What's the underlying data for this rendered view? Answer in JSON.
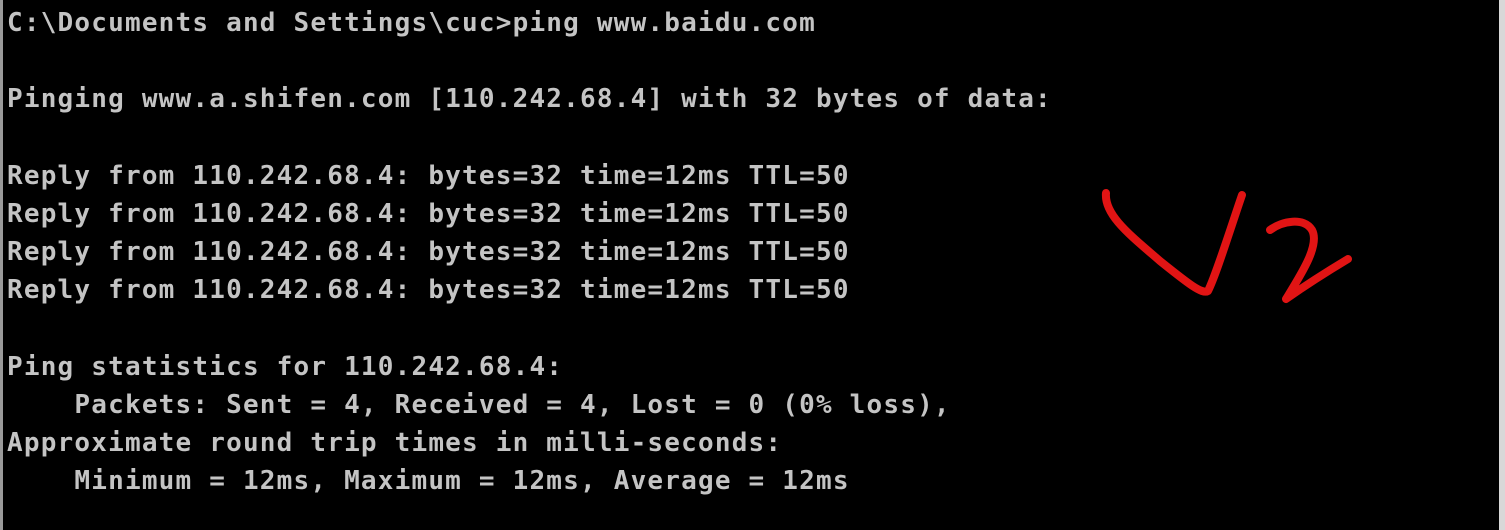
{
  "console": {
    "lines": [
      "C:\\Documents and Settings\\cuc>ping www.baidu.com",
      "",
      "Pinging www.a.shifen.com [110.242.68.4] with 32 bytes of data:",
      "",
      "Reply from 110.242.68.4: bytes=32 time=12ms TTL=50",
      "Reply from 110.242.68.4: bytes=32 time=12ms TTL=50",
      "Reply from 110.242.68.4: bytes=32 time=12ms TTL=50",
      "Reply from 110.242.68.4: bytes=32 time=12ms TTL=50",
      "",
      "Ping statistics for 110.242.68.4:",
      "    Packets: Sent = 4, Received = 4, Lost = 0 (0% loss),",
      "Approximate round trip times in milli-seconds:",
      "    Minimum = 12ms, Maximum = 12ms, Average = 12ms"
    ]
  },
  "annotation": {
    "label": "V2",
    "color": "#e11414"
  },
  "colors": {
    "background": "#000000",
    "text": "#c4c4c4"
  }
}
